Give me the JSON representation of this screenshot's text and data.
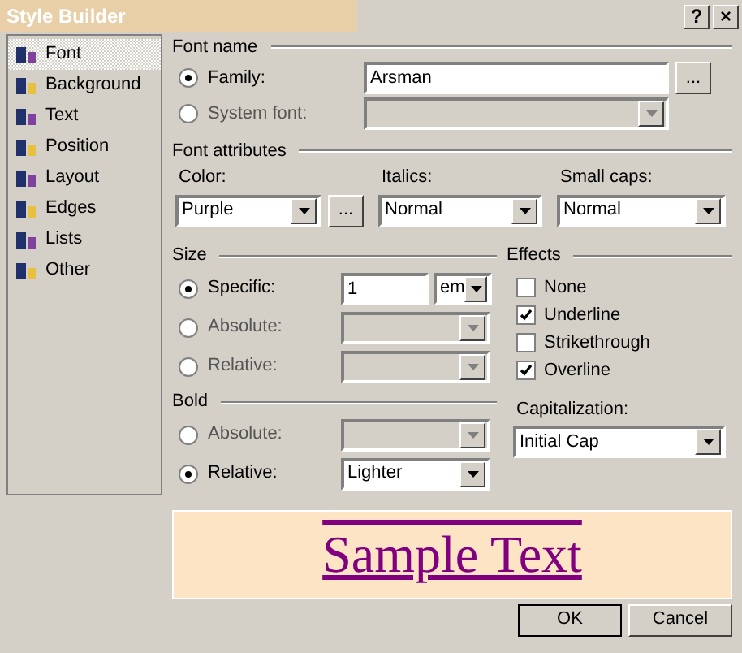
{
  "window": {
    "title": "Style Builder",
    "title_buttons": [
      "?",
      "×"
    ]
  },
  "sidebar": {
    "items": [
      {
        "label": "Font",
        "selected": true
      },
      {
        "label": "Background",
        "selected": false
      },
      {
        "label": "Text",
        "selected": false
      },
      {
        "label": "Position",
        "selected": false
      },
      {
        "label": "Layout",
        "selected": false
      },
      {
        "label": "Edges",
        "selected": false
      },
      {
        "label": "Lists",
        "selected": false
      },
      {
        "label": "Other",
        "selected": false
      }
    ]
  },
  "font_name": {
    "title": "Font name",
    "options": [
      {
        "label": "Family:",
        "selected": true,
        "disabled": false,
        "value": "Arsman",
        "button": "..."
      },
      {
        "label": "System font:",
        "selected": false,
        "disabled": true
      }
    ]
  },
  "font_attributes": {
    "title": "Font attributes",
    "fields": [
      {
        "label": "Color:",
        "value": "Purple",
        "button": "..."
      },
      {
        "label": "Italics:",
        "value": "Normal"
      },
      {
        "label": "Small caps:",
        "value": "Normal"
      }
    ]
  },
  "size": {
    "title": "Size",
    "options": [
      {
        "label": "Specific:",
        "selected": true,
        "disabled": false,
        "value": "1",
        "unit": "em"
      },
      {
        "label": "Absolute:",
        "selected": false,
        "disabled": true
      },
      {
        "label": "Relative:",
        "selected": false,
        "disabled": true
      }
    ]
  },
  "effects": {
    "title": "Effects",
    "items": [
      {
        "label": "None",
        "checked": false
      },
      {
        "label": "Underline",
        "checked": true
      },
      {
        "label": "Strikethrough",
        "checked": false
      },
      {
        "label": "Overline",
        "checked": true
      }
    ]
  },
  "bold": {
    "title": "Bold",
    "options": [
      {
        "label": "Absolute:",
        "selected": false,
        "disabled": true
      },
      {
        "label": "Relative:",
        "selected": true,
        "disabled": false,
        "value": "Lighter"
      }
    ]
  },
  "capitalization": {
    "label": "Capitalization:",
    "value": "Initial Cap"
  },
  "preview": {
    "text": "Sample Text"
  },
  "buttons": [
    "OK",
    "Cancel"
  ]
}
